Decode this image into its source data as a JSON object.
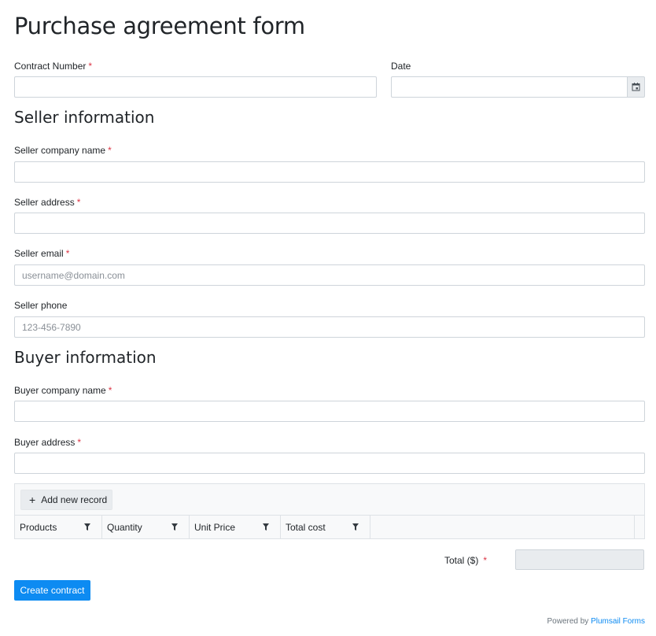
{
  "form": {
    "title": "Purchase agreement form",
    "contract_number": {
      "label": "Contract Number",
      "required": "*",
      "value": "",
      "placeholder": ""
    },
    "date": {
      "label": "Date",
      "value": "",
      "placeholder": ""
    }
  },
  "seller": {
    "section_title": "Seller information",
    "company_name": {
      "label": "Seller company name",
      "required": "*",
      "value": "",
      "placeholder": ""
    },
    "address": {
      "label": "Seller address",
      "required": "*",
      "value": "",
      "placeholder": ""
    },
    "email": {
      "label": "Seller email",
      "required": "*",
      "value": "",
      "placeholder": "username@domain.com"
    },
    "phone": {
      "label": "Seller phone",
      "value": "",
      "placeholder": "123-456-7890"
    }
  },
  "buyer": {
    "section_title": "Buyer information",
    "company_name": {
      "label": "Buyer company name",
      "required": "*",
      "value": "",
      "placeholder": ""
    },
    "address": {
      "label": "Buyer address",
      "required": "*",
      "value": "",
      "placeholder": ""
    }
  },
  "grid": {
    "add_button": {
      "icon": "+",
      "label": "Add new record"
    },
    "columns": [
      "Products",
      "Quantity",
      "Unit Price",
      "Total cost"
    ],
    "filter_icon": "filter-icon"
  },
  "total": {
    "label": "Total ($)",
    "required": "*",
    "value": ""
  },
  "submit_label": "Create contract",
  "footer": {
    "powered_by": "Powered by",
    "link": "Plumsail Forms"
  },
  "colors": {
    "accent": "#0d8bf2",
    "required": "#dc3545",
    "border": "#ced4da",
    "disabled_bg": "#e9ecef"
  }
}
